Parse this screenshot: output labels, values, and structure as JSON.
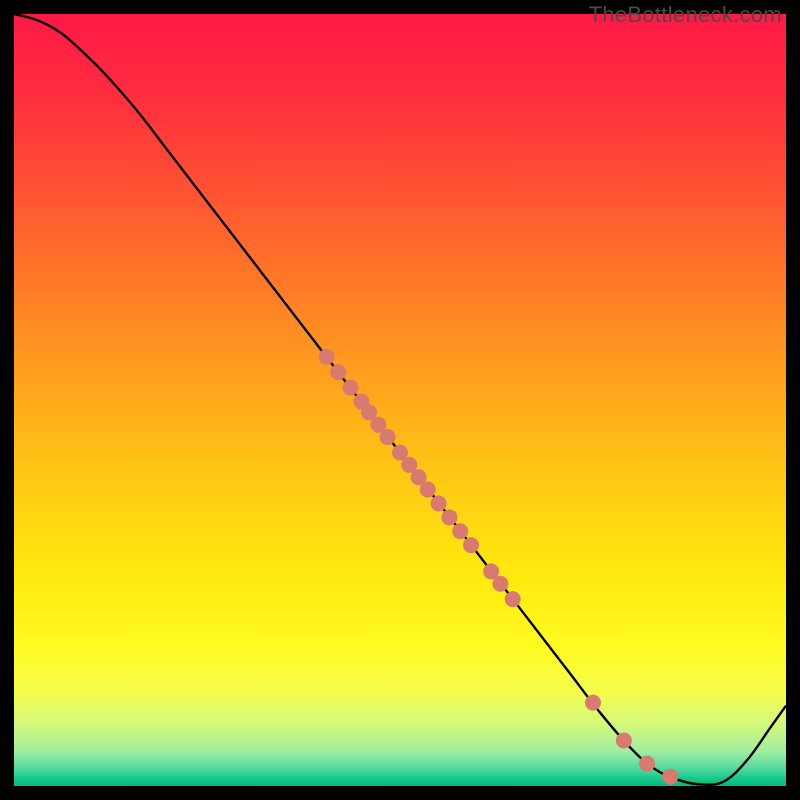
{
  "credit": "TheBottleneck.com",
  "colors": {
    "curve": "#000000",
    "dot_fill": "#d97a70",
    "dot_stroke": "#b55a52"
  },
  "chart_data": {
    "type": "line",
    "title": "",
    "xlabel": "",
    "ylabel": "",
    "xlim": [
      0,
      100
    ],
    "ylim": [
      0,
      100
    ],
    "grid": false,
    "series": [
      {
        "name": "bottleneck-curve",
        "x": [
          0,
          3,
          6,
          9,
          12,
          16,
          20,
          24,
          28,
          32,
          36,
          40,
          44,
          48,
          52,
          56,
          60,
          64,
          68,
          72,
          76,
          80,
          83,
          86,
          89,
          92,
          95,
          98,
          100
        ],
        "y": [
          100,
          99.2,
          97.6,
          95.0,
          92.0,
          87.4,
          82.2,
          77.0,
          71.8,
          66.6,
          61.4,
          56.2,
          51.0,
          45.8,
          40.6,
          35.4,
          30.2,
          25.0,
          19.8,
          14.6,
          9.4,
          4.8,
          2.2,
          0.8,
          0.2,
          0.6,
          3.4,
          7.6,
          10.4
        ]
      },
      {
        "name": "highlighted-points",
        "type": "scatter",
        "x": [
          40.5,
          42.0,
          43.6,
          45.0,
          46.0,
          47.2,
          48.4,
          50.0,
          51.2,
          52.4,
          53.6,
          55.0,
          56.4,
          57.8,
          59.2,
          61.8,
          63.0,
          64.6,
          75.0,
          79.0,
          82.0,
          85.0
        ],
        "y": [
          55.6,
          53.6,
          51.6,
          49.8,
          48.4,
          46.8,
          45.2,
          43.2,
          41.6,
          40.0,
          38.4,
          36.6,
          34.8,
          33.0,
          31.2,
          27.8,
          26.2,
          24.2,
          10.8,
          5.9,
          2.9,
          1.2
        ]
      }
    ],
    "background_gradient": {
      "type": "vertical",
      "stops": [
        {
          "pos": 0.0,
          "color": "#ff1946"
        },
        {
          "pos": 0.1,
          "color": "#ff2c3f"
        },
        {
          "pos": 0.22,
          "color": "#ff5033"
        },
        {
          "pos": 0.35,
          "color": "#ff7a27"
        },
        {
          "pos": 0.48,
          "color": "#ffa31d"
        },
        {
          "pos": 0.6,
          "color": "#ffc814"
        },
        {
          "pos": 0.72,
          "color": "#ffe80e"
        },
        {
          "pos": 0.82,
          "color": "#fffb20"
        },
        {
          "pos": 0.88,
          "color": "#f4fd4e"
        },
        {
          "pos": 0.92,
          "color": "#d3f97a"
        },
        {
          "pos": 0.955,
          "color": "#a0eea0"
        },
        {
          "pos": 0.975,
          "color": "#5bdca0"
        },
        {
          "pos": 0.99,
          "color": "#17c98c"
        },
        {
          "pos": 1.0,
          "color": "#04b877"
        }
      ]
    }
  }
}
